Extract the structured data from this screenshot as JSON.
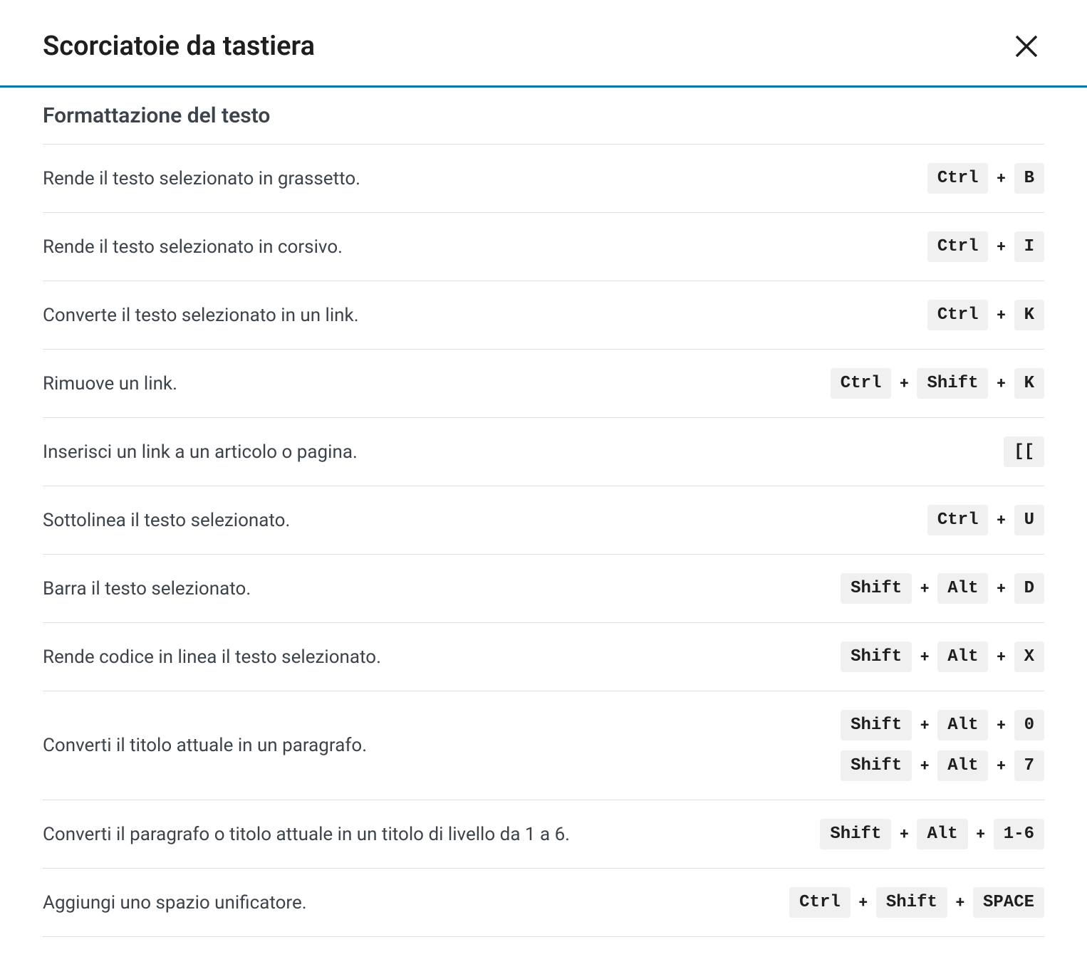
{
  "modal": {
    "title": "Scorciatoie da tastiera"
  },
  "section": {
    "title": "Formattazione del testo"
  },
  "shortcuts": [
    {
      "desc": "Rende il testo selezionato in grassetto.",
      "combos": [
        [
          "Ctrl",
          "B"
        ]
      ]
    },
    {
      "desc": "Rende il testo selezionato in corsivo.",
      "combos": [
        [
          "Ctrl",
          "I"
        ]
      ]
    },
    {
      "desc": "Converte il testo selezionato in un link.",
      "combos": [
        [
          "Ctrl",
          "K"
        ]
      ]
    },
    {
      "desc": "Rimuove un link.",
      "combos": [
        [
          "Ctrl",
          "Shift",
          "K"
        ]
      ]
    },
    {
      "desc": "Inserisci un link a un articolo o pagina.",
      "combos": [
        [
          "[["
        ]
      ]
    },
    {
      "desc": "Sottolinea il testo selezionato.",
      "combos": [
        [
          "Ctrl",
          "U"
        ]
      ]
    },
    {
      "desc": "Barra il testo selezionato.",
      "combos": [
        [
          "Shift",
          "Alt",
          "D"
        ]
      ]
    },
    {
      "desc": "Rende codice in linea il testo selezionato.",
      "combos": [
        [
          "Shift",
          "Alt",
          "X"
        ]
      ]
    },
    {
      "desc": "Converti il titolo attuale in un paragrafo.",
      "combos": [
        [
          "Shift",
          "Alt",
          "0"
        ],
        [
          "Shift",
          "Alt",
          "7"
        ]
      ]
    },
    {
      "desc": "Converti il paragrafo o titolo attuale in un titolo di livello da 1 a 6.",
      "combos": [
        [
          "Shift",
          "Alt",
          "1-6"
        ]
      ]
    },
    {
      "desc": "Aggiungi uno spazio unificatore.",
      "combos": [
        [
          "Ctrl",
          "Shift",
          "SPACE"
        ]
      ]
    }
  ]
}
